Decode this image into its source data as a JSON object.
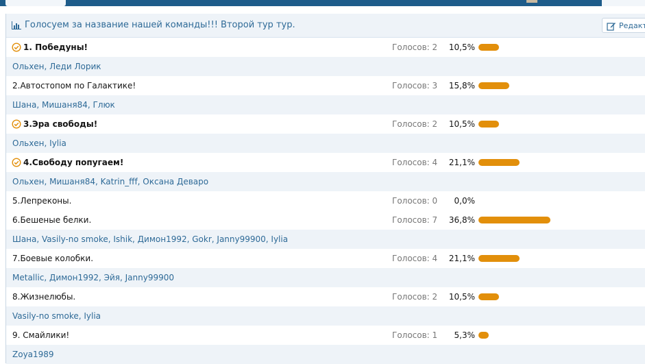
{
  "poll": {
    "title": "Голосуем за название нашей команды!!! Второй тур тур.",
    "edit_label": "Редакти",
    "votes_prefix": "Голосов:",
    "options": [
      {
        "label": "1. Победуны!",
        "votes": "Голосов: 2",
        "percent": "10,5%",
        "share": 10.5,
        "selected": true,
        "voters": "Ольхен, Леди Лорик"
      },
      {
        "label": "2.Автостопом по Галактике!",
        "votes": "Голосов: 3",
        "percent": "15,8%",
        "share": 15.8,
        "selected": false,
        "voters": "Шана, Мишаня84, Глюк"
      },
      {
        "label": "3.Эра свободы!",
        "votes": "Голосов: 2",
        "percent": "10,5%",
        "share": 10.5,
        "selected": true,
        "voters": "Ольхен, Iylia"
      },
      {
        "label": "4.Свободу попугаем!",
        "votes": "Голосов: 4",
        "percent": "21,1%",
        "share": 21.1,
        "selected": true,
        "voters": "Ольхен, Мишаня84, Katrin_fff, Оксана Деваро"
      },
      {
        "label": "5.Лепреконы.",
        "votes": "Голосов: 0",
        "percent": "0,0%",
        "share": 0,
        "selected": false,
        "voters": null
      },
      {
        "label": "6.Бешеные белки.",
        "votes": "Голосов: 7",
        "percent": "36,8%",
        "share": 36.8,
        "selected": false,
        "voters": "Шана, Vasily-no smoke, Ishik, Димон1992, Gokr, Janny99900, Iylia"
      },
      {
        "label": "7.Боевые колобки.",
        "votes": "Голосов: 4",
        "percent": "21,1%",
        "share": 21.1,
        "selected": false,
        "voters": "Metallic, Димон1992, Эйя, Janny99900"
      },
      {
        "label": "8.Жизнелюбы.",
        "votes": "Голосов: 2",
        "percent": "10,5%",
        "share": 10.5,
        "selected": false,
        "voters": "Vasily-no smoke, Iylia"
      },
      {
        "label": "9. Смайлики!",
        "votes": "Голосов: 1",
        "percent": "5,3%",
        "share": 5.3,
        "selected": false,
        "voters": "Zoya1989"
      }
    ]
  },
  "colors": {
    "bar": "#e28f0b",
    "link": "#2e6a97",
    "voters_row_bg": "#eef3f8",
    "top_bar": "#1e5c8a"
  },
  "icons": {
    "poll": "bar-chart-icon",
    "edit": "edit-icon",
    "selected": "check-circle-icon"
  }
}
